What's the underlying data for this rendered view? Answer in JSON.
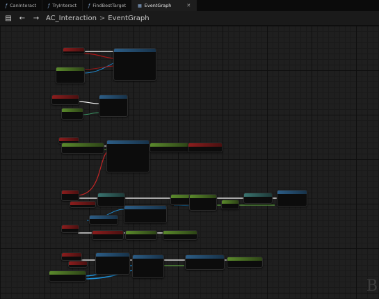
{
  "tabs": [
    {
      "label": "CanInteract",
      "icon": "function-icon",
      "active": false
    },
    {
      "label": "TryInteract",
      "icon": "function-icon",
      "active": false
    },
    {
      "label": "FindBestTarget",
      "icon": "function-icon",
      "active": false
    },
    {
      "label": "EventGraph",
      "icon": "graph-icon",
      "active": true
    }
  ],
  "toolbar": {
    "breadcrumb_root": "AC_Interaction",
    "breadcrumb_separator": ">",
    "breadcrumb_current": "EventGraph"
  },
  "colors": {
    "exec_wire": "#ffffff",
    "event_header": "#8c1d1d",
    "function_header": "#2c5d86",
    "pure_header": "#5b8a2c",
    "object_wire": "#1f8fd6",
    "bool_wire": "#b01515",
    "struct_wire": "#3ea16b"
  }
}
